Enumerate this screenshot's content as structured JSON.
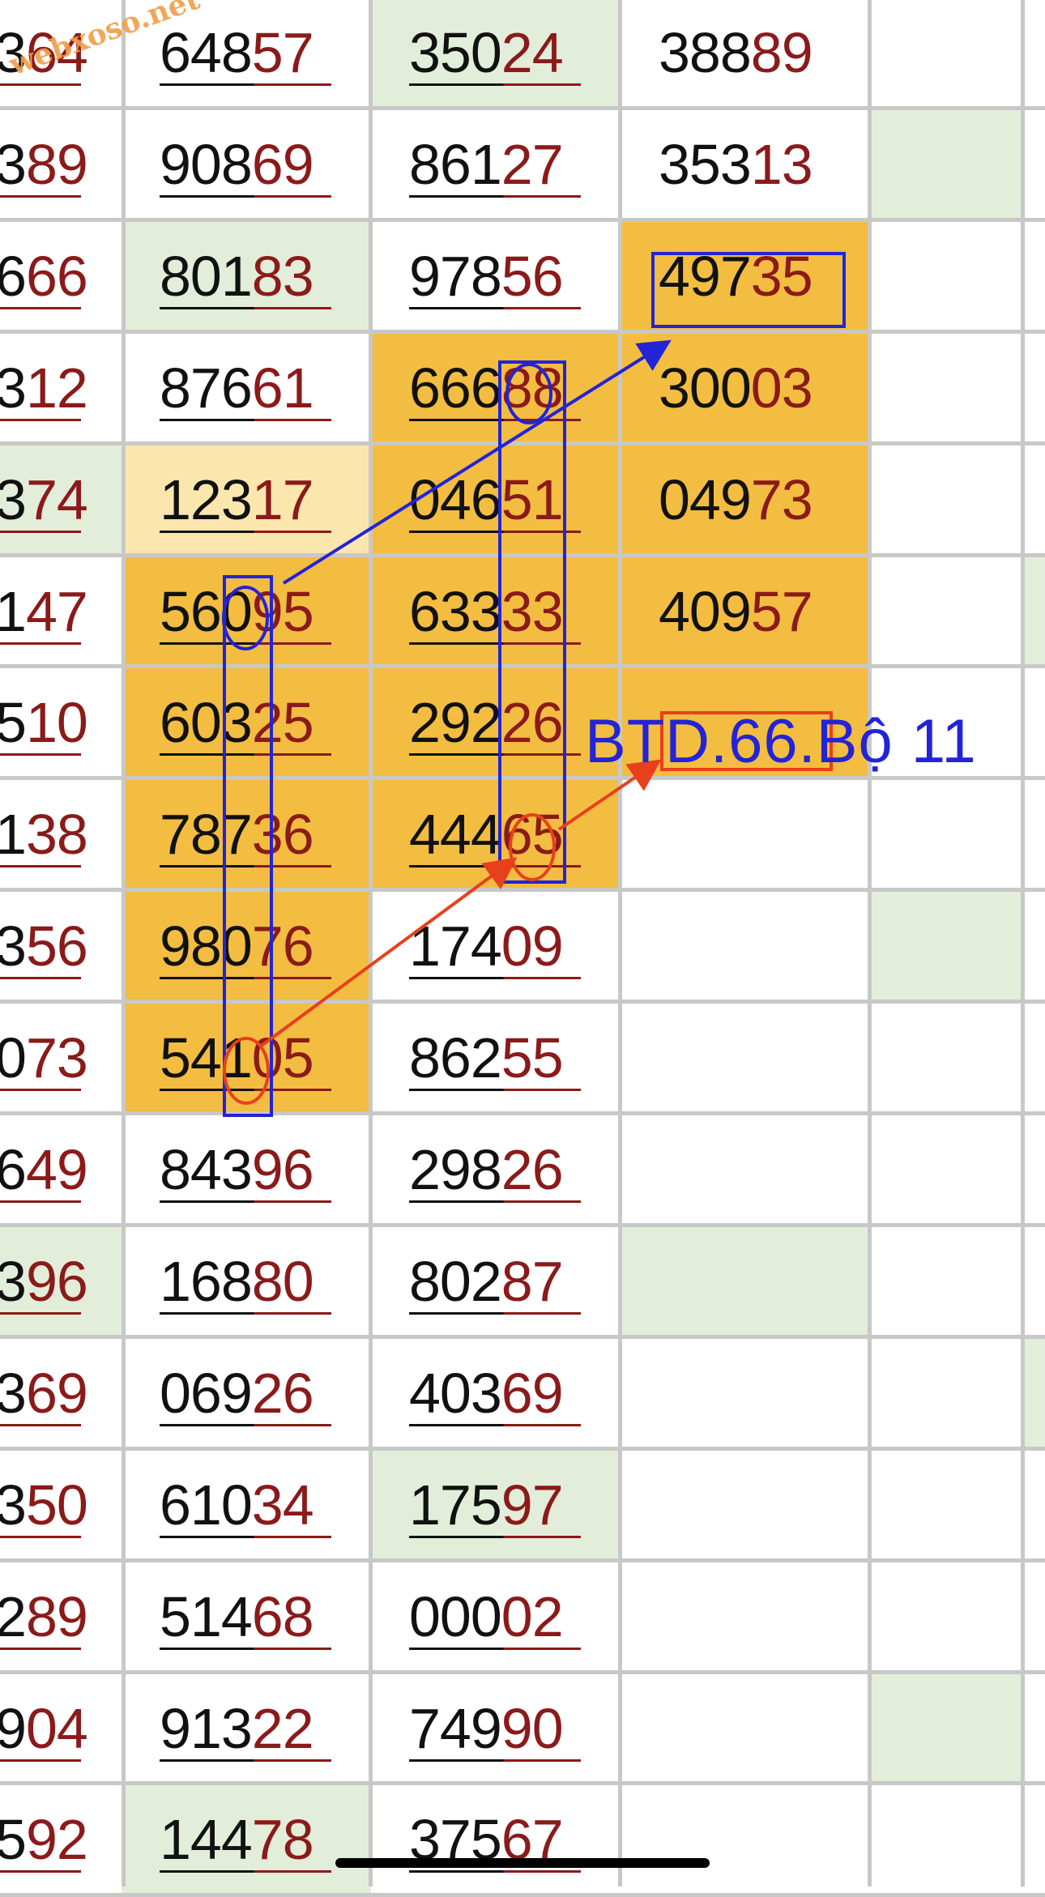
{
  "watermark": "webxoso.net",
  "caption": "BTD.66.Bộ 11",
  "colors": {
    "black_digits": "#111111",
    "red_digits": "#8b1a1a",
    "highlight_orange": "#f2bd40",
    "highlight_pale": "#fbe7ae",
    "light_green": "#e2eed9",
    "blue_marker": "#2323d8",
    "red_marker": "#e8401c"
  },
  "icons": [
    "blue-rectangle-marker",
    "blue-ellipse-marker",
    "red-ellipse-marker",
    "blue-arrow",
    "red-arrow"
  ],
  "rows": [
    {
      "c0": {
        "a": "3",
        "b": "64"
      },
      "c1": {
        "a": "648",
        "b": "57"
      },
      "c2": {
        "a": "350",
        "b": "24"
      },
      "c3": {
        "a": "388",
        "b": "89"
      }
    },
    {
      "c0": {
        "a": "3",
        "b": "89"
      },
      "c1": {
        "a": "908",
        "b": "69"
      },
      "c2": {
        "a": "861",
        "b": "27"
      },
      "c3": {
        "a": "353",
        "b": "13"
      }
    },
    {
      "c0": {
        "a": "6",
        "b": "66"
      },
      "c1": {
        "a": "801",
        "b": "83"
      },
      "c2": {
        "a": "978",
        "b": "56"
      },
      "c3": {
        "a": "497",
        "b": "35"
      }
    },
    {
      "c0": {
        "a": "3",
        "b": "12"
      },
      "c1": {
        "a": "876",
        "b": "61"
      },
      "c2": {
        "a": "666",
        "b": "88"
      },
      "c3": {
        "a": "300",
        "b": "03"
      }
    },
    {
      "c0": {
        "a": "3",
        "b": "74"
      },
      "c1": {
        "a": "123",
        "b": "17"
      },
      "c2": {
        "a": "046",
        "b": "51"
      },
      "c3": {
        "a": "049",
        "b": "73"
      }
    },
    {
      "c0": {
        "a": "1",
        "b": "47"
      },
      "c1": {
        "a": "560",
        "b": "95"
      },
      "c2": {
        "a": "633",
        "b": "33"
      },
      "c3": {
        "a": "409",
        "b": "57"
      }
    },
    {
      "c0": {
        "a": "5",
        "b": "10"
      },
      "c1": {
        "a": "603",
        "b": "25"
      },
      "c2": {
        "a": "292",
        "b": "26"
      },
      "c3": {
        "a": "",
        "b": ""
      }
    },
    {
      "c0": {
        "a": "1",
        "b": "38"
      },
      "c1": {
        "a": "787",
        "b": "36"
      },
      "c2": {
        "a": "444",
        "b": "65"
      },
      "c3": {
        "a": "",
        "b": ""
      }
    },
    {
      "c0": {
        "a": "3",
        "b": "56"
      },
      "c1": {
        "a": "980",
        "b": "76"
      },
      "c2": {
        "a": "174",
        "b": "09"
      },
      "c3": {
        "a": "",
        "b": ""
      }
    },
    {
      "c0": {
        "a": "0",
        "b": "73"
      },
      "c1": {
        "a": "541",
        "b": "05"
      },
      "c2": {
        "a": "862",
        "b": "55"
      },
      "c3": {
        "a": "",
        "b": ""
      }
    },
    {
      "c0": {
        "a": "6",
        "b": "49"
      },
      "c1": {
        "a": "843",
        "b": "96"
      },
      "c2": {
        "a": "298",
        "b": "26"
      },
      "c3": {
        "a": "",
        "b": ""
      }
    },
    {
      "c0": {
        "a": "3",
        "b": "96"
      },
      "c1": {
        "a": "168",
        "b": "80"
      },
      "c2": {
        "a": "802",
        "b": "87"
      },
      "c3": {
        "a": "",
        "b": ""
      }
    },
    {
      "c0": {
        "a": "3",
        "b": "69"
      },
      "c1": {
        "a": "069",
        "b": "26"
      },
      "c2": {
        "a": "403",
        "b": "69"
      },
      "c3": {
        "a": "",
        "b": ""
      }
    },
    {
      "c0": {
        "a": "3",
        "b": "50"
      },
      "c1": {
        "a": "610",
        "b": "34"
      },
      "c2": {
        "a": "175",
        "b": "97"
      },
      "c3": {
        "a": "",
        "b": ""
      }
    },
    {
      "c0": {
        "a": "2",
        "b": "89"
      },
      "c1": {
        "a": "514",
        "b": "68"
      },
      "c2": {
        "a": "000",
        "b": "02"
      },
      "c3": {
        "a": "",
        "b": ""
      }
    },
    {
      "c0": {
        "a": "9",
        "b": "04"
      },
      "c1": {
        "a": "913",
        "b": "22"
      },
      "c2": {
        "a": "749",
        "b": "90"
      },
      "c3": {
        "a": "",
        "b": ""
      }
    },
    {
      "c0": {
        "a": "5",
        "b": "92"
      },
      "c1": {
        "a": "144",
        "b": "78"
      },
      "c2": {
        "a": "375",
        "b": "67"
      },
      "c3": {
        "a": "",
        "b": ""
      }
    }
  ]
}
